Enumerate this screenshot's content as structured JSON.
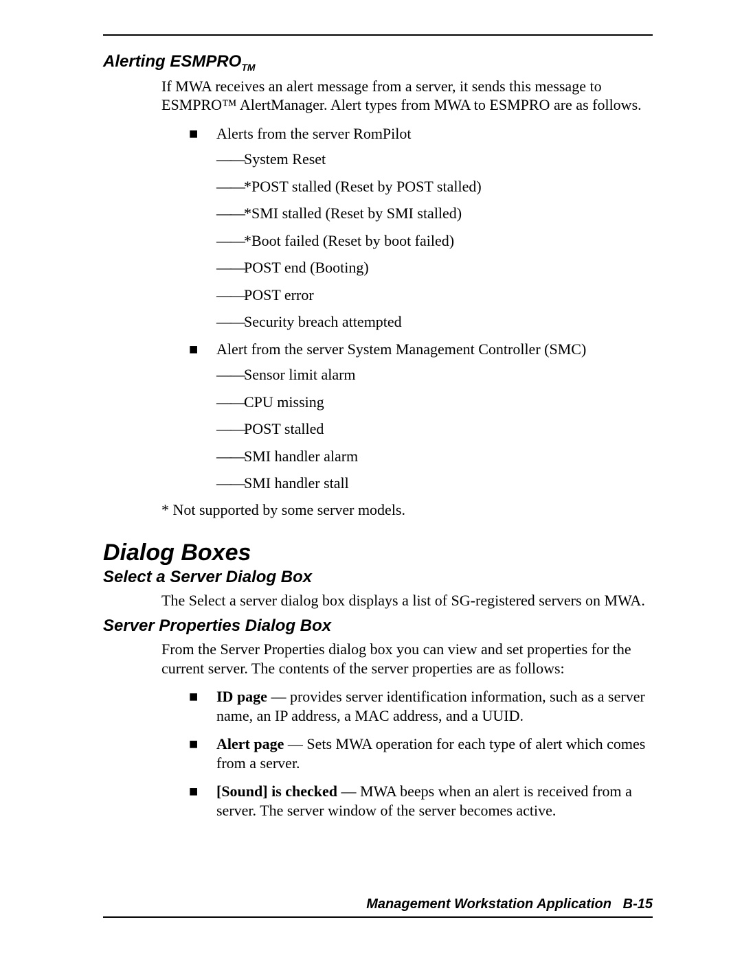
{
  "section1": {
    "heading_main": "Alerting ESMPRO",
    "heading_tm": "TM",
    "intro": "If MWA receives an alert message from a server, it sends this message to ESMPRO™ AlertManager. Alert types from MWA to ESMPRO are as follows.",
    "bullet1": "Alerts from the server RomPilot",
    "b1_subs": [
      "System Reset",
      "*POST stalled (Reset by POST stalled)",
      "*SMI stalled (Reset by SMI stalled)",
      "*Boot failed (Reset by boot failed)",
      "POST end (Booting)",
      "POST error",
      "Security breach attempted"
    ],
    "bullet2": "Alert from the server System Management Controller (SMC)",
    "b2_subs": [
      "Sensor limit alarm",
      "CPU missing",
      "POST stalled",
      "SMI handler alarm",
      "SMI handler stall"
    ],
    "footnote": "* Not supported by some server models."
  },
  "section2": {
    "heading": "Dialog Boxes",
    "sub1_heading": "Select a Server Dialog Box",
    "sub1_body": "The Select a server dialog box displays a list of SG-registered servers on MWA.",
    "sub2_heading": "Server Properties Dialog Box",
    "sub2_body": "From the Server Properties dialog box you can view and set properties for the current server. The contents of the server properties are as follows:",
    "props": [
      {
        "bold": "ID page",
        "rest": " — provides server identification information, such as a server name, an IP address, a MAC address, and a UUID."
      },
      {
        "bold": "Alert page",
        "rest": " — Sets MWA operation for each type of alert which comes from a server."
      },
      {
        "bold": "[Sound] is checked",
        "rest": " — MWA beeps when an alert is received from a server.  The server window of the server becomes active."
      }
    ]
  },
  "footer": {
    "title": "Management Workstation Application",
    "pageno": "B-15"
  }
}
